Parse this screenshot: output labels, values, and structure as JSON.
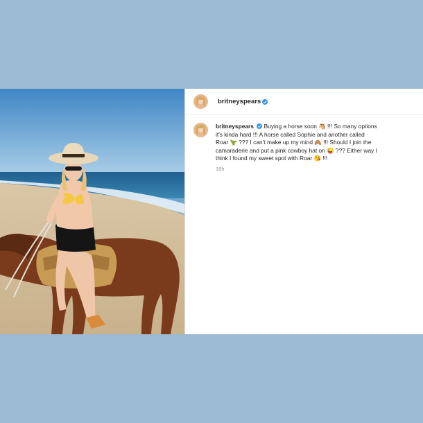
{
  "post": {
    "username": "britneyspears",
    "verified_icon": "verified-badge-icon",
    "caption_username": "britneyspears",
    "caption_lines": [
      "Buying a horse soon 🐴 !!! So many options",
      "it's kinda hard !!! A horse called Sophie and another called",
      "Roar 🦖 ??? I can't make up my mind 🙈 !!! Should I join the",
      "camaraderie and put a pink cowboy hat on 😜 ??? Either way I",
      "think I found my sweet spot with Roar 😘 !!!"
    ],
    "timestamp": "16h"
  },
  "colors": {
    "background": "#9cbad3",
    "verified": "#3897f0"
  }
}
